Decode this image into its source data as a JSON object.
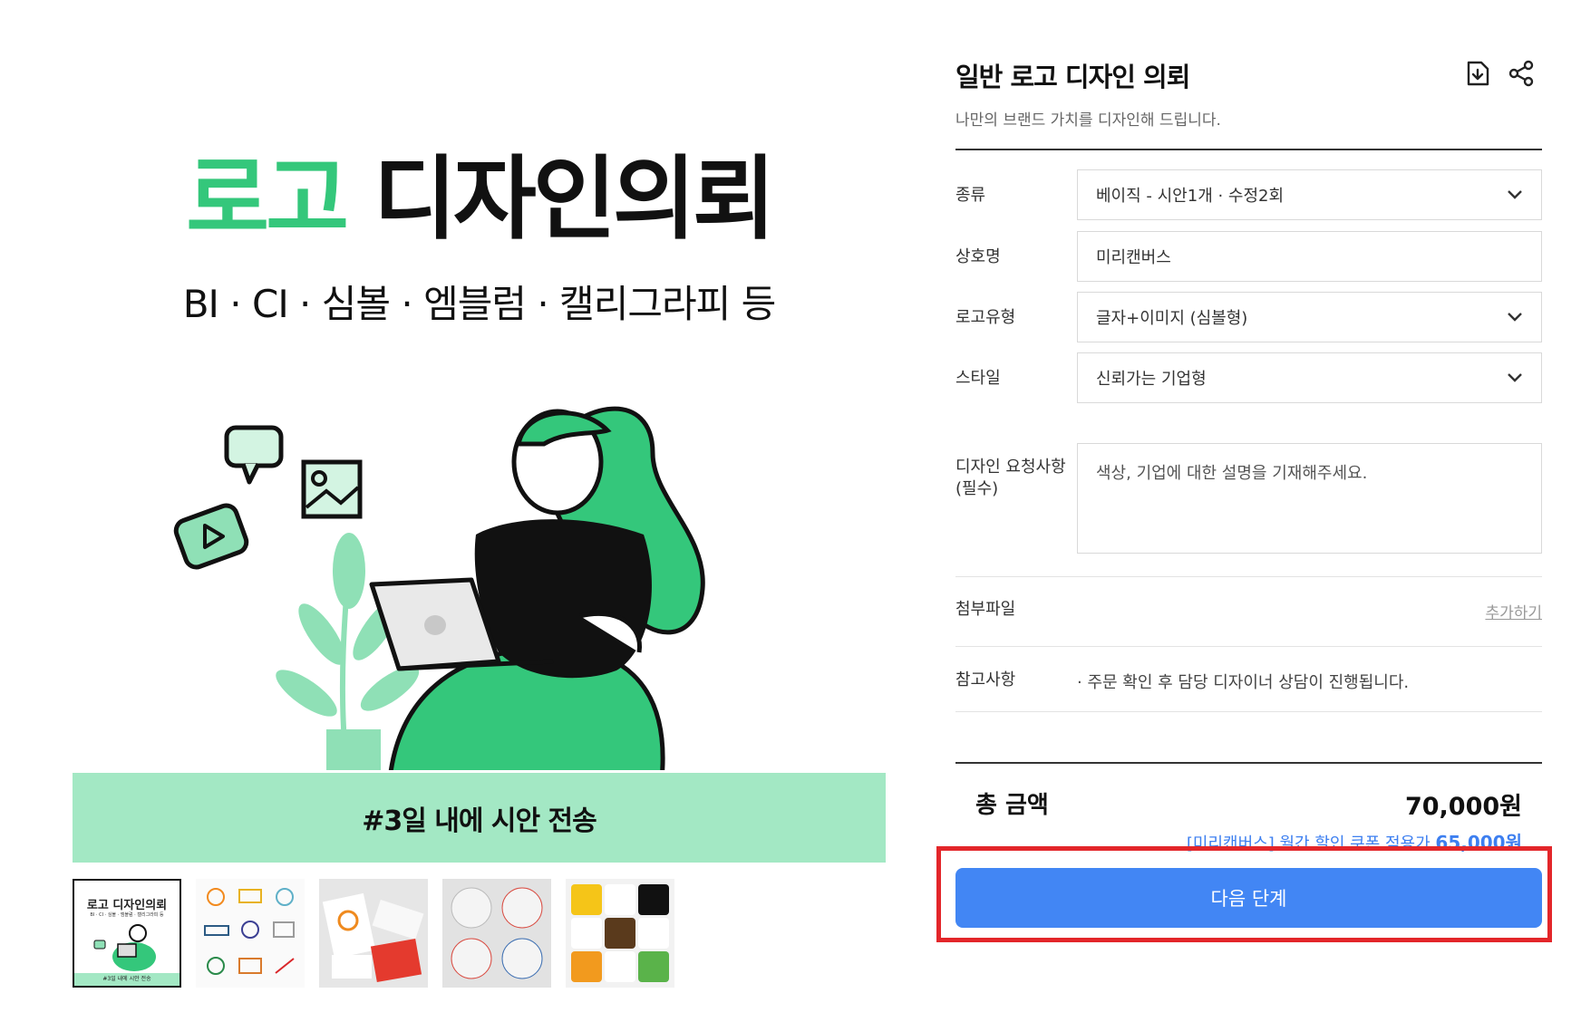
{
  "hero": {
    "title_green": "로고",
    "title_black": "디자인의뢰",
    "subtitle": "BI · CI · 심볼 · 엠블럼 · 캘리그라피 등",
    "band_text": "#3일 내에 시안 전송"
  },
  "thumbnail_mini": {
    "title": "로고 디자인의뢰",
    "subtitle": "BI · CI · 심볼 · 엠블럼 · 캘리그라피 등",
    "band": "#3일 내에 시안 전송"
  },
  "product": {
    "title": "일반 로고 디자인 의뢰",
    "description": "나만의 브랜드 가치를 디자인해 드립니다."
  },
  "form": {
    "type_label": "종류",
    "type_value": "베이직 - 시안1개 · 수정2회",
    "company_label": "상호명",
    "company_value": "미리캔버스",
    "logo_type_label": "로고유형",
    "logo_type_value": "글자+이미지 (심볼형)",
    "style_label": "스타일",
    "style_value": "신뢰가는 기업형",
    "request_label": "디자인 요청사항\n(필수)",
    "request_placeholder": "색상, 기업에 대한 설명을 기재해주세요.",
    "attach_label": "첨부파일",
    "attach_link": "추가하기",
    "note_label": "참고사항",
    "note_text": "· 주문 확인 후 담당 디자이너 상담이 진행됩니다."
  },
  "total": {
    "label": "총 금액",
    "value": "70,000원",
    "coupon_text": "[미리캔버스] 월간 할인 쿠폰 적용가",
    "coupon_price": "65,000원"
  },
  "actions": {
    "next_button": "다음 단계"
  },
  "colors": {
    "accent_green": "#34c77b",
    "light_green": "#a3e8c4",
    "primary_blue": "#4286f4",
    "highlight_red": "#e3262a"
  },
  "icons": [
    "download-icon",
    "share-icon",
    "chevron-down-icon"
  ]
}
